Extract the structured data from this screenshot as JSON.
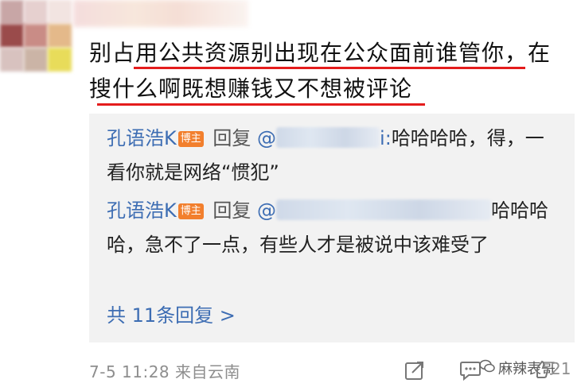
{
  "comment": {
    "line1": "别占用公共资源别出现在公众面前谁管你，在",
    "line2": "搜什么啊既想赚钱又不想被评论"
  },
  "replies": [
    {
      "user": "孔语浩K",
      "badge": "博主",
      "reply_word": "回复",
      "mention_prefix": "@",
      "mention_visible_suffix": "i:",
      "text": "哈哈哈哈，得，一看你就是网络“惯犯”"
    },
    {
      "user": "孔语浩K",
      "badge": "博主",
      "reply_word": "回复",
      "mention_prefix": "@",
      "text": "哈哈哈哈，急不了一点，有些人才是被说中该难受了"
    }
  ],
  "more_replies": "共 11条回复 >",
  "footer": {
    "timestamp": "7-5 11:28 来自云南",
    "like_count": "21",
    "watermark": "麻辣表哥"
  },
  "colors": {
    "accent_blue": "#3d6db3",
    "badge_orange": "#f27f2d",
    "underline_red": "#e41c1c",
    "reply_bg": "#f2f2f2"
  },
  "icons": [
    "share-icon",
    "comment-icon",
    "like-icon",
    "wechat-icon"
  ]
}
